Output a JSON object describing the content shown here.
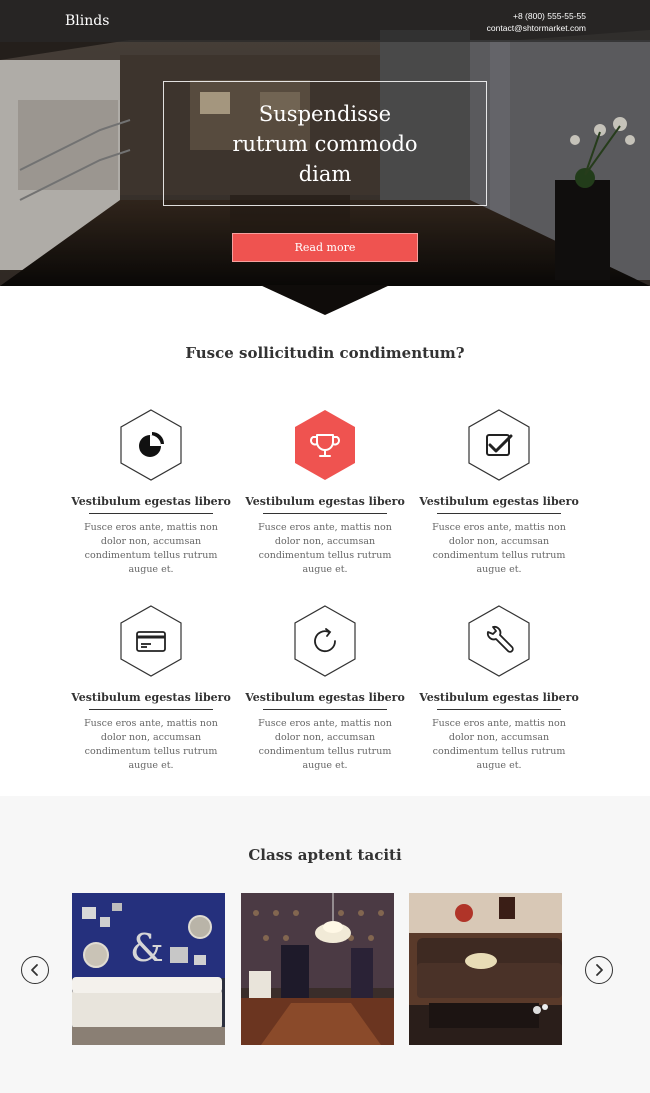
{
  "header": {
    "logo": "Blinds",
    "phone": "+8 (800) 555-55-55",
    "email": "contact@shtormarket.com"
  },
  "hero": {
    "title": "Suspendisse rutrum commodo diam",
    "button_label": "Read more"
  },
  "features": {
    "title": "Fusce sollicitudin condimentum?",
    "items": [
      {
        "icon": "pie-chart-icon",
        "title": "Vestibulum egestas libero",
        "text": "Fusce eros ante, mattis non dolor non, accumsan condimentum tellus rutrum augue et.",
        "highlighted": false
      },
      {
        "icon": "trophy-icon",
        "title": "Vestibulum egestas libero",
        "text": "Fusce eros ante, mattis non dolor non, accumsan condimentum tellus rutrum augue et.",
        "highlighted": true
      },
      {
        "icon": "checkmark-icon",
        "title": "Vestibulum egestas libero",
        "text": "Fusce eros ante, mattis non dolor non, accumsan condimentum tellus rutrum augue et.",
        "highlighted": false
      },
      {
        "icon": "credit-card-icon",
        "title": "Vestibulum egestas libero",
        "text": "Fusce eros ante, mattis non dolor non, accumsan condimentum tellus rutrum augue et.",
        "highlighted": false
      },
      {
        "icon": "refresh-icon",
        "title": "Vestibulum egestas libero",
        "text": "Fusce eros ante, mattis non dolor non, accumsan condimentum tellus rutrum augue et.",
        "highlighted": false
      },
      {
        "icon": "wrench-icon",
        "title": "Vestibulum egestas libero",
        "text": "Fusce eros ante, mattis non dolor non, accumsan condimentum tellus rutrum augue et.",
        "highlighted": false
      }
    ]
  },
  "gallery": {
    "title": "Class aptent taciti",
    "prev_icon": "chevron-left-icon",
    "next_icon": "chevron-right-icon"
  },
  "colors": {
    "accent": "#ef5350",
    "text": "#333333",
    "muted": "#666666"
  }
}
